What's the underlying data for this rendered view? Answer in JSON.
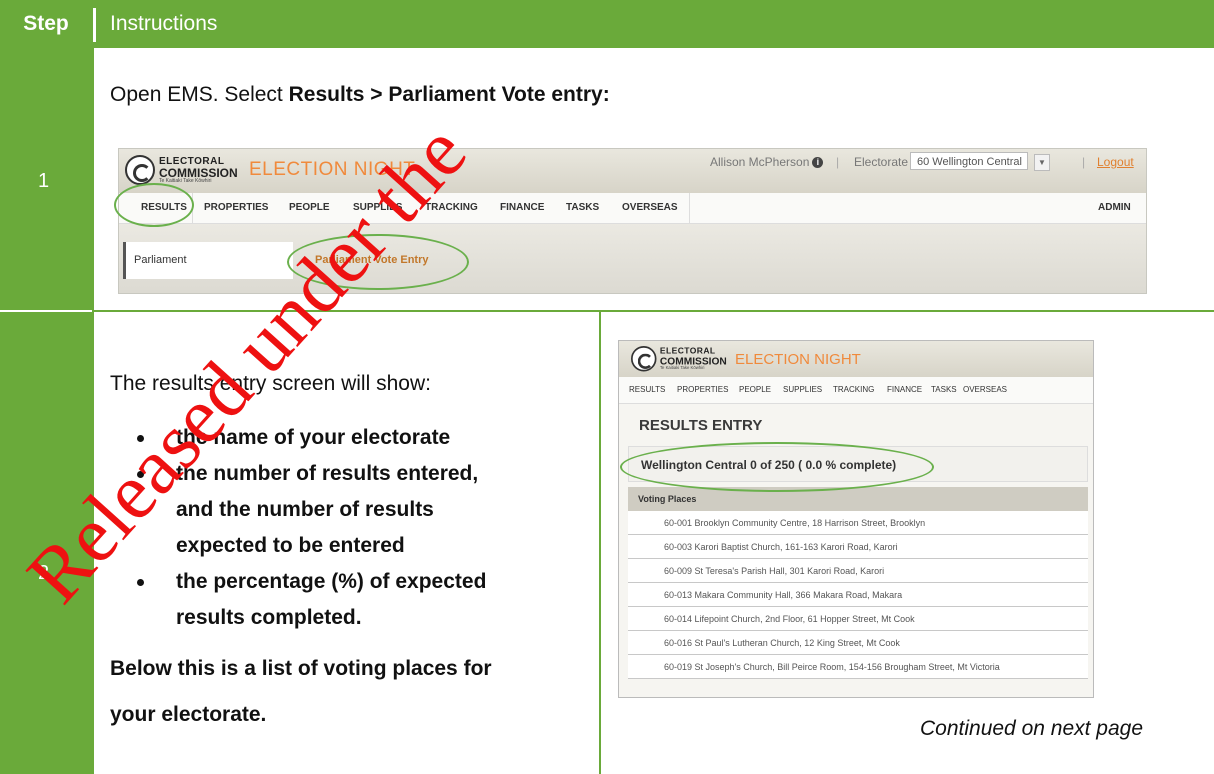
{
  "header": {
    "step": "Step",
    "instructions": "Instructions"
  },
  "rows": [
    {
      "number": "1",
      "title_prefix": "Open EMS. Select ",
      "title_bold": "Results > Parliament Vote entry:"
    },
    {
      "number": "2"
    }
  ],
  "ems1": {
    "logo": {
      "line1": "ELECTORAL",
      "line2": "COMMISSION",
      "line3": "Te Kaitiaki Take Kōwhiri"
    },
    "app_title": "ELECTION NIGHT",
    "user": "Allison McPherson",
    "electorate_label": "Electorate",
    "electorate_value": "60 Wellington Central",
    "logout": "Logout",
    "nav": [
      "RESULTS",
      "PROPERTIES",
      "PEOPLE",
      "SUPPLIES",
      "TRACKING",
      "FINANCE",
      "TASKS",
      "OVERSEAS"
    ],
    "admin": "ADMIN",
    "sub_left": "Parliament",
    "sub_link": "Parliament Vote Entry"
  },
  "row2": {
    "intro": "The results entry screen will show:",
    "bullets": [
      "the name of your electorate",
      "the number of results entered,",
      "and the number of results",
      "expected to be entered",
      "the percentage (%) of expected",
      "results completed."
    ],
    "below1": "Below this is a list of voting places for",
    "below2": "your electorate."
  },
  "ems2": {
    "app_title": "ELECTION NIGHT",
    "nav": [
      "RESULTS",
      "PROPERTIES",
      "PEOPLE",
      "SUPPLIES",
      "TRACKING",
      "FINANCE",
      "TASKS",
      "OVERSEAS"
    ],
    "heading": "RESULTS ENTRY",
    "status": "Wellington Central 0 of 250 ( 0.0 % complete)",
    "voting_places_header": "Voting Places",
    "voting_places": [
      "60-001 Brooklyn Community Centre, 18 Harrison Street, Brooklyn",
      "60-003 Karori Baptist Church, 161-163 Karori Road, Karori",
      "60-009 St Teresa's Parish Hall, 301 Karori Road, Karori",
      "60-013 Makara Community Hall, 366 Makara Road, Makara",
      "60-014 Lifepoint Church, 2nd Floor, 61 Hopper Street, Mt Cook",
      "60-016 St Paul's Lutheran Church, 12 King Street, Mt Cook",
      "60-019 St Joseph's Church, Bill Peirce Room, 154-156 Brougham Street, Mt Victoria"
    ]
  },
  "continued": "Continued on next page",
  "watermark": "Released under the",
  "colors": {
    "green": "#6aaa3a",
    "orange": "#f08a3c",
    "watermark_red": "#ee1111"
  }
}
